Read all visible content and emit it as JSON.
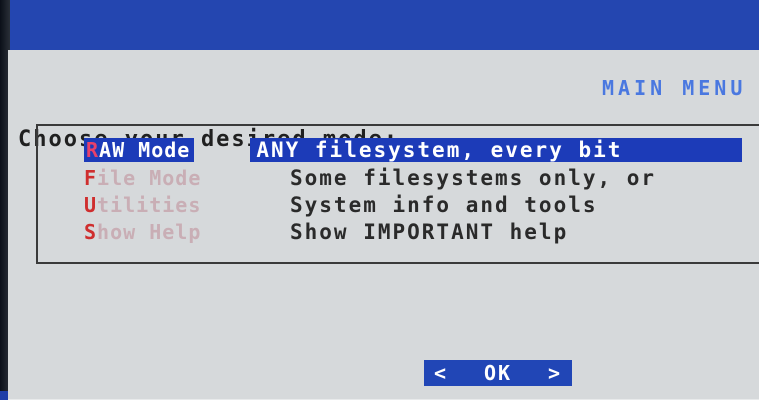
{
  "header": {
    "title": "MAIN MENU"
  },
  "prompt": "Choose your desired mode:",
  "menu": {
    "items": [
      {
        "hotkey": "R",
        "rest": "AW Mode",
        "description": "ANY filesystem, every bit",
        "selected": true
      },
      {
        "hotkey": "F",
        "rest": "ile Mode",
        "description": "Some filesystems only, or",
        "selected": false
      },
      {
        "hotkey": "U",
        "rest": "tilities",
        "description": "System info and tools",
        "selected": false
      },
      {
        "hotkey": "S",
        "rest": "how Help",
        "description": "Show IMPORTANT help",
        "selected": false
      }
    ]
  },
  "button": {
    "left_arrow": "<",
    "label": "OK",
    "right_arrow": ">"
  },
  "colors": {
    "background": "#1e3ea8",
    "dialog": "#d6d9db",
    "selection": "#1c3bb8",
    "hotkey": "#cf2e2e"
  }
}
